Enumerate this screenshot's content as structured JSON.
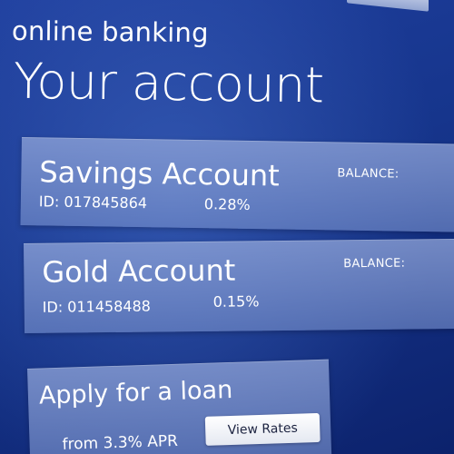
{
  "header": {
    "brand": "online banking",
    "title": "Your account"
  },
  "accounts": [
    {
      "name": "Savings Account",
      "id_text": "ID: 017845864",
      "rate": "0.28%",
      "balance_label": "BALANCE:"
    },
    {
      "name": "Gold Account",
      "id_text": "ID: 011458488",
      "rate": "0.15%",
      "balance_label": "BALANCE:"
    }
  ],
  "loan": {
    "title": "Apply for a loan",
    "subtitle": "from 3.3% APR",
    "button_label": "View Rates"
  },
  "colors": {
    "background": "#16358c",
    "card": "#8fa3d6",
    "text": "#ffffff",
    "button": "#f2f4f8"
  }
}
